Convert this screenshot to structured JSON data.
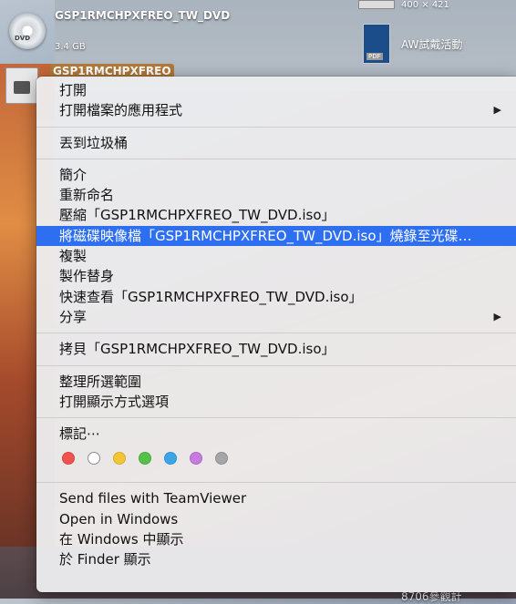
{
  "desktop": {
    "dvd": {
      "icon_text": "DVD",
      "name": "GSP1RMCHPXFREO_TW_DVD",
      "size": "3.4 GB"
    },
    "selected_file_label": "GSP1RMCHPXFREO",
    "dimensions_label": "400 × 421",
    "pdf": {
      "icon_text": "PDF",
      "name": "AW試戴活動"
    },
    "bottom_label": "8706參觀計"
  },
  "menu": {
    "groups": [
      [
        {
          "label": "打開",
          "submenu": false
        },
        {
          "label": "打開檔案的應用程式",
          "submenu": true
        }
      ],
      [
        {
          "label": "丟到垃圾桶",
          "submenu": false
        }
      ],
      [
        {
          "label": "簡介",
          "submenu": false
        },
        {
          "label": "重新命名",
          "submenu": false
        },
        {
          "label": "壓縮「GSP1RMCHPXFREO_TW_DVD.iso」",
          "submenu": false
        },
        {
          "label": "將磁碟映像檔「GSP1RMCHPXFREO_TW_DVD.iso」燒錄至光碟…",
          "submenu": false,
          "highlighted": true
        },
        {
          "label": "複製",
          "submenu": false
        },
        {
          "label": "製作替身",
          "submenu": false
        },
        {
          "label": "快速查看「GSP1RMCHPXFREO_TW_DVD.iso」",
          "submenu": false
        },
        {
          "label": "分享",
          "submenu": true
        }
      ],
      [
        {
          "label": "拷貝「GSP1RMCHPXFREO_TW_DVD.iso」",
          "submenu": false
        }
      ],
      [
        {
          "label": "整理所選範圍",
          "submenu": false
        },
        {
          "label": "打開顯示方式選項",
          "submenu": false
        }
      ],
      [
        {
          "label": "標記⋯",
          "submenu": false
        }
      ],
      [
        {
          "label": "Send files with TeamViewer",
          "submenu": false
        },
        {
          "label": "Open in Windows",
          "submenu": false
        },
        {
          "label": "在 Windows 中顯示",
          "submenu": false
        },
        {
          "label": "於 Finder 顯示",
          "submenu": false
        }
      ]
    ],
    "submenu_arrow": "▶",
    "tags": [
      {
        "name": "red",
        "color": "#f0534f",
        "hollow": false
      },
      {
        "name": "gray-outline",
        "color": "#c9c9c9",
        "hollow": true
      },
      {
        "name": "yellow",
        "color": "#f4c534",
        "hollow": false
      },
      {
        "name": "green",
        "color": "#55c148",
        "hollow": false
      },
      {
        "name": "blue",
        "color": "#3ca5e8",
        "hollow": false
      },
      {
        "name": "purple",
        "color": "#c77be0",
        "hollow": false
      },
      {
        "name": "gray",
        "color": "#a5a5a7",
        "hollow": false
      }
    ],
    "highlight_color": "#2e6ff1"
  }
}
